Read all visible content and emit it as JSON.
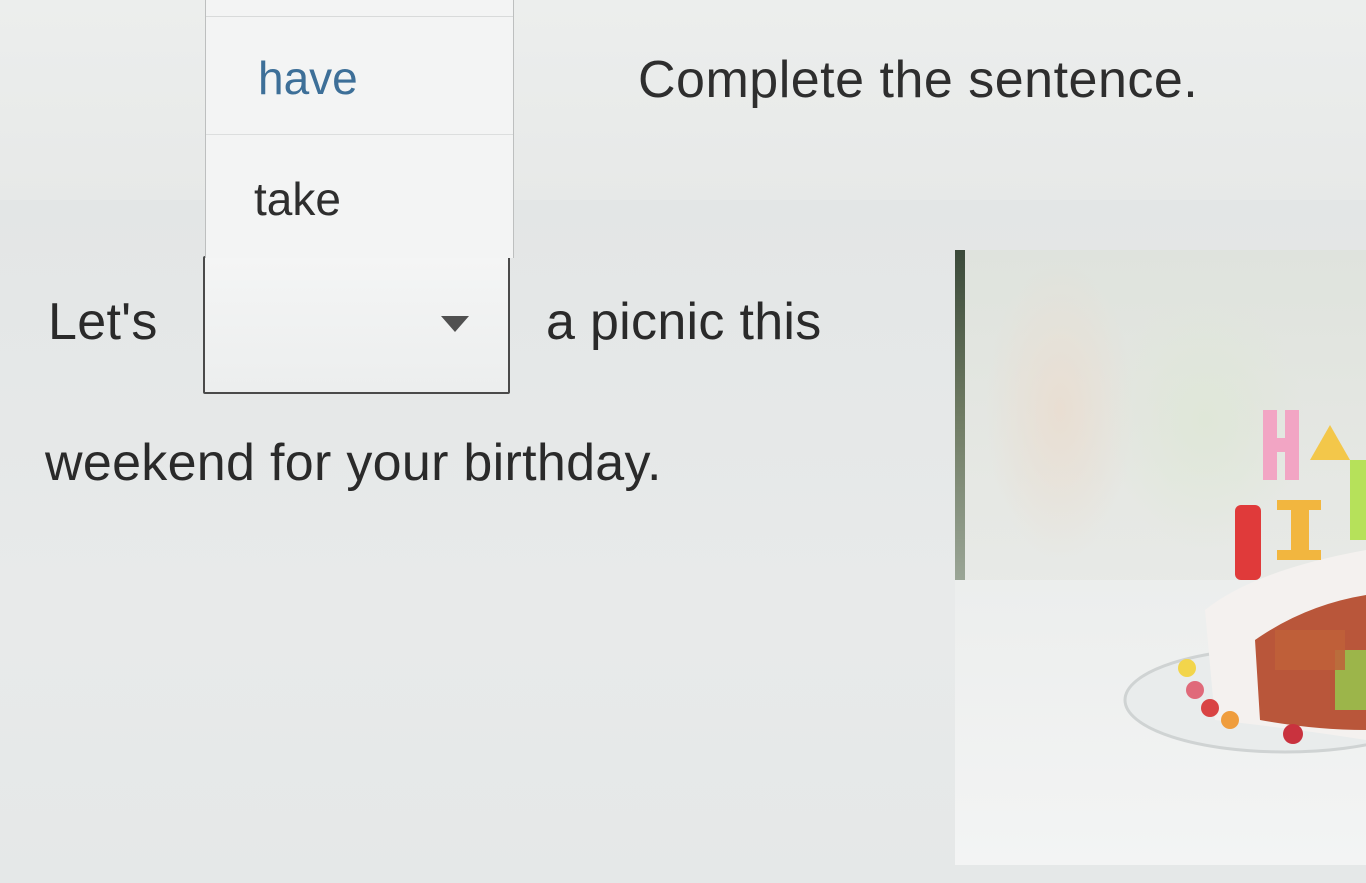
{
  "instruction": "Complete the sentence.",
  "sentence": {
    "before": "Let's",
    "after": "a picnic this",
    "line2": "weekend for your birthday."
  },
  "dropdown": {
    "selected": "",
    "options": [
      "have",
      "take"
    ]
  },
  "image": {
    "icon": "birthday-cake-photo",
    "candle_letters": "H A B I"
  },
  "colors": {
    "option_highlight_text": "#3d6f98",
    "text": "#2a2a2a",
    "background": "#e9ebea"
  }
}
